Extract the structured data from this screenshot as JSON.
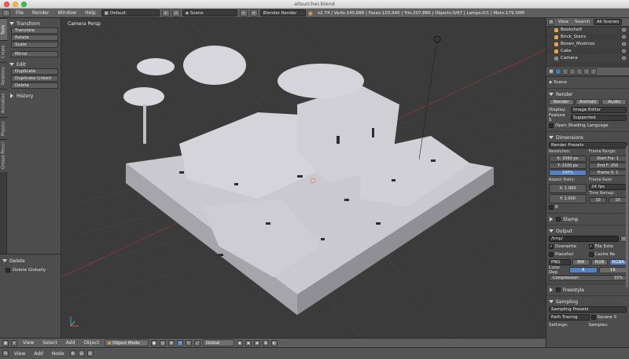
{
  "window": {
    "title": "allsurcher.blend"
  },
  "info_header": {
    "menus": [
      "File",
      "Render",
      "Window",
      "Help"
    ],
    "layout": "Default",
    "scene": "Scene",
    "engine": "Blender Render",
    "stats": "v2.74 | Verts:140,886 | Faces:103,940 | Tris:207,880 | Objects:0/67 | Lamps:0/1 | Mem:179.30M"
  },
  "left_tabs": [
    "Tools",
    "Create",
    "Relations",
    "Animation",
    "Physics",
    "Grease Pencil"
  ],
  "tool_shelf": {
    "transform": {
      "title": "Transform",
      "buttons": [
        "Translate",
        "Rotate",
        "Scale",
        "Mirror"
      ]
    },
    "edit": {
      "title": "Edit",
      "buttons": [
        "Duplicate",
        "Duplicate Linked",
        "Delete"
      ]
    },
    "history": {
      "title": "History"
    }
  },
  "operator_panel": {
    "title": "Delete",
    "option": "Delete Globally"
  },
  "viewport": {
    "label": "Camera Persp"
  },
  "view_header": {
    "menus": [
      "View",
      "Select",
      "Add",
      "Object"
    ],
    "mode": "Object Mode",
    "pivot": "Global"
  },
  "timeline_header": {
    "menus": [
      "View",
      "Add",
      "Node"
    ]
  },
  "outliner": {
    "tabs": [
      "View",
      "Search",
      "All Scenes"
    ],
    "items": [
      "Bookshelf",
      "Brick_Stairs",
      "Brown_Mushroo",
      "Cake",
      "Camera"
    ]
  },
  "properties": {
    "scene_label": "Scene",
    "render": {
      "title": "Render",
      "buttons": [
        "Render",
        "Animati",
        "Audio"
      ],
      "display_label": "Display:",
      "display_value": "Image Editor",
      "feature_label": "Feature S",
      "feature_value": "Supported",
      "open_shading": "Open Shading Language"
    },
    "dimensions": {
      "title": "Dimensions",
      "preset": "Render Presets",
      "resolution_label": "Resolution:",
      "res_x": "X: 3360 px",
      "res_y": "Y: 2100 px",
      "res_pct": "100%",
      "frame_range_label": "Frame Range:",
      "start": "Start Fra: 1",
      "end": "End F: 250",
      "step": "Frame S: 1",
      "aspect_label": "Aspect Ratio:",
      "asp_x": "X: 1.000",
      "asp_y": "Y: 1.000",
      "frame_rate_label": "Frame Rate:",
      "fps": "24 fps",
      "remap_label": "Time Remap:",
      "remap_old": "10",
      "remap_new": "10",
      "b_label": "B"
    },
    "stamp": {
      "title": "Stamp"
    },
    "output": {
      "title": "Output",
      "path": "/tmp/",
      "overwrite": "Overwrite",
      "file_ext": "File Exte",
      "placeholders": "Placehol",
      "cache": "Cache Re",
      "format": "PNG",
      "bw": "BW",
      "rgb": "RGB",
      "rgba": "RGBA",
      "color_depth_label": "Color Dep",
      "depth_8": "8",
      "depth_16": "16",
      "compression": "Compression:",
      "compression_value": "15%"
    },
    "freestyle": {
      "title": "Freestyle"
    },
    "sampling": {
      "title": "Sampling",
      "preset": "Sampling Presets",
      "path": "Path Tracing",
      "square": "Square S",
      "settings_label": "Settings:",
      "samples_label": "Samples:"
    }
  }
}
